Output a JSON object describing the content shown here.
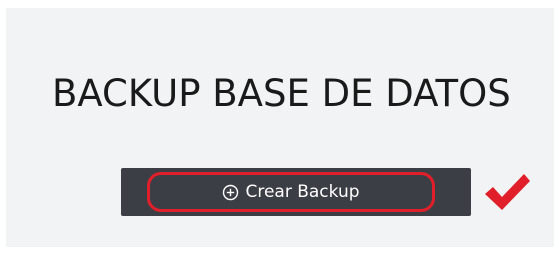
{
  "title": "BACKUP BASE DE DATOS",
  "button": {
    "label": "Crear Backup",
    "icon": "plus-circle-icon"
  },
  "annotation": {
    "checkmark_icon": "checkmark-icon",
    "highlight_color": "#e01f2a"
  },
  "colors": {
    "background": "#f1f3f4",
    "button_bg": "#3b3f45",
    "button_text": "#ffffff",
    "title_text": "#1a1a1a"
  }
}
